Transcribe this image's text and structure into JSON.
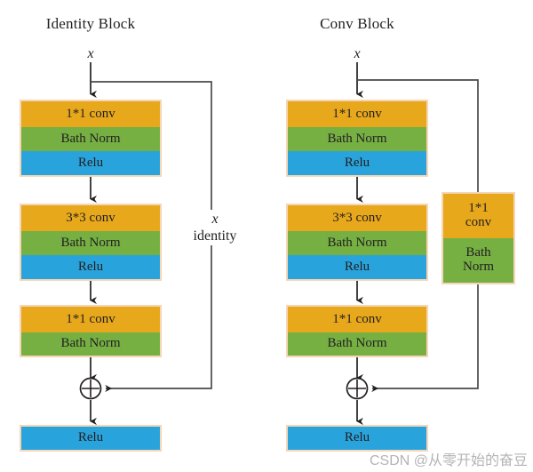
{
  "diagram": {
    "watermark": "CSDN @从零开始的奋豆",
    "colors": {
      "orange": "#e8a81c",
      "green": "#76b043",
      "blue": "#29a3dc",
      "border": "#f6d6b6",
      "line": "#231f20",
      "text": "#231f20",
      "watermark": "#b4b4b4"
    }
  },
  "identity_block": {
    "title": "Identity Block",
    "input_label": "x",
    "skip_label_x": "x",
    "skip_label_text": "identity",
    "group1": {
      "conv": "1*1 conv",
      "norm": "Bath Norm",
      "relu": "Relu"
    },
    "group2": {
      "conv": "3*3 conv",
      "norm": "Bath Norm",
      "relu": "Relu"
    },
    "group3": {
      "conv": "1*1 conv",
      "norm": "Bath Norm"
    },
    "merge_symbol": "+",
    "output_relu": "Relu"
  },
  "conv_block": {
    "title": "Conv Block",
    "input_label": "x",
    "group1": {
      "conv": "1*1 conv",
      "norm": "Bath Norm",
      "relu": "Relu"
    },
    "group2": {
      "conv": "3*3 conv",
      "norm": "Bath Norm",
      "relu": "Relu"
    },
    "group3": {
      "conv": "1*1 conv",
      "norm": "Bath Norm"
    },
    "shortcut": {
      "conv_line1": "1*1",
      "conv_line2": "conv",
      "norm_line1": "Bath",
      "norm_line2": "Norm"
    },
    "merge_symbol": "+",
    "output_relu": "Relu"
  }
}
